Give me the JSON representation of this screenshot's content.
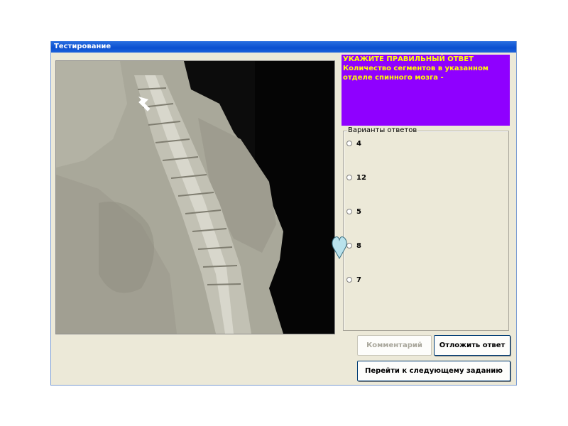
{
  "window": {
    "title": "Тестирование"
  },
  "question": {
    "heading": "УКАЖИТЕ ПРАВИЛЬНЫЙ ОТВЕТ",
    "text": "Количество сегментов в указанном отделе спинного мозга -",
    "panel_color": "#8f00ff",
    "text_color": "#ffff00"
  },
  "answers": {
    "legend": "Варианты ответов",
    "options": [
      "4",
      "12",
      "5",
      "8",
      "7"
    ]
  },
  "buttons": {
    "comment": "Комментарий",
    "postpone": "Отложить ответ",
    "next": "Перейти к следующему заданию"
  }
}
